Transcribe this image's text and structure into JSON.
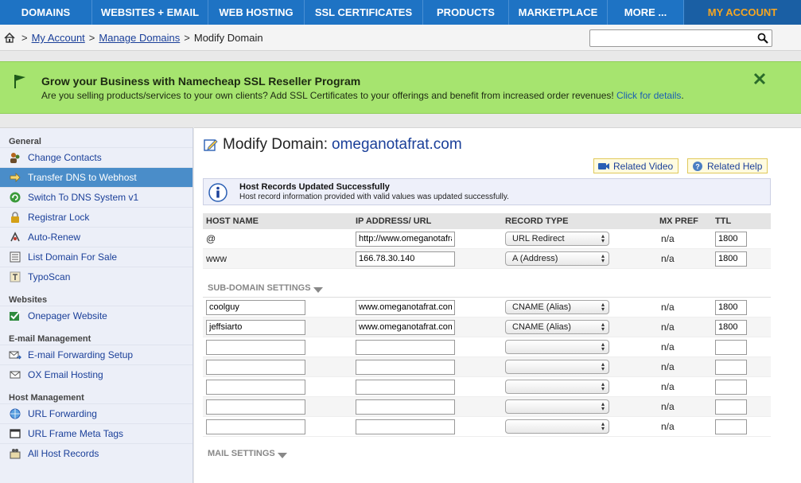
{
  "nav": {
    "items": [
      "DOMAINS",
      "WEBSITES + EMAIL",
      "WEB HOSTING",
      "SSL CERTIFICATES",
      "PRODUCTS",
      "MARKETPLACE",
      "MORE ...",
      "MY ACCOUNT"
    ]
  },
  "breadcrumb": {
    "my_account": "My Account",
    "manage_domains": "Manage Domains",
    "current": "Modify Domain",
    "separator": ">"
  },
  "search": {
    "value": "",
    "placeholder": ""
  },
  "banner": {
    "title": "Grow your Business with Namecheap SSL Reseller Program",
    "text": "Are you selling products/services to your own clients? Add SSL Certificates to your offerings and benefit from increased order revenues! ",
    "link": "Click for details",
    "text_end": "."
  },
  "sidebar": {
    "sections": [
      {
        "title": "General",
        "items": [
          {
            "label": "Change Contacts",
            "icon": "contacts-icon"
          },
          {
            "label": "Transfer DNS to Webhost",
            "icon": "arrow-right-icon",
            "active": true
          },
          {
            "label": "Switch To DNS System v1",
            "icon": "refresh-icon"
          },
          {
            "label": "Registrar Lock",
            "icon": "lock-icon"
          },
          {
            "label": "Auto-Renew",
            "icon": "renew-icon"
          },
          {
            "label": "List Domain For Sale",
            "icon": "list-icon"
          },
          {
            "label": "TypoScan",
            "icon": "typoscan-icon"
          }
        ]
      },
      {
        "title": "Websites",
        "items": [
          {
            "label": "Onepager Website",
            "icon": "checkmark-icon"
          }
        ]
      },
      {
        "title": "E-mail Management",
        "items": [
          {
            "label": "E-mail Forwarding Setup",
            "icon": "email-forward-icon"
          },
          {
            "label": "OX Email Hosting",
            "icon": "email-icon"
          }
        ]
      },
      {
        "title": "Host Management",
        "items": [
          {
            "label": "URL Forwarding",
            "icon": "globe-icon"
          },
          {
            "label": "URL Frame Meta Tags",
            "icon": "frame-icon"
          },
          {
            "label": "All Host Records",
            "icon": "host-records-icon"
          }
        ]
      }
    ]
  },
  "main": {
    "title": "Modify Domain:",
    "domain": "omeganotafrat.com",
    "related_video": "Related Video",
    "related_help": "Related Help",
    "message_title": "Host Records Updated Successfully",
    "message_text": "Host record information provided with valid values was updated successfully.",
    "headers": [
      "HOST NAME",
      "IP ADDRESS/ URL",
      "RECORD TYPE",
      "MX PREF",
      "TTL"
    ],
    "host_records": [
      {
        "host": "@",
        "ip": "http://www.omeganotafrat.com",
        "type": "URL Redirect",
        "mx": "n/a",
        "ttl": "1800"
      },
      {
        "host": "www",
        "ip": "166.78.30.140",
        "type": "A (Address)",
        "mx": "n/a",
        "ttl": "1800"
      }
    ],
    "subdomain_label": "SUB-DOMAIN SETTINGS",
    "subdomains": [
      {
        "host": "coolguy",
        "ip": "www.omeganotafrat.com",
        "type": "CNAME (Alias)",
        "mx": "n/a",
        "ttl": "1800"
      },
      {
        "host": "jeffsiarto",
        "ip": "www.omeganotafrat.com",
        "type": "CNAME (Alias)",
        "mx": "n/a",
        "ttl": "1800"
      },
      {
        "host": "",
        "ip": "",
        "type": "",
        "mx": "n/a",
        "ttl": ""
      },
      {
        "host": "",
        "ip": "",
        "type": "",
        "mx": "n/a",
        "ttl": ""
      },
      {
        "host": "",
        "ip": "",
        "type": "",
        "mx": "n/a",
        "ttl": ""
      },
      {
        "host": "",
        "ip": "",
        "type": "",
        "mx": "n/a",
        "ttl": ""
      },
      {
        "host": "",
        "ip": "",
        "type": "",
        "mx": "n/a",
        "ttl": ""
      }
    ],
    "mail_label": "MAIL SETTINGS"
  },
  "colors": {
    "nav_bg": "#1e73c4",
    "nav_active_text": "#f5a623",
    "banner_bg": "#a6e46f",
    "sidebar_active": "#4a8dc9",
    "link": "#1a3f99"
  }
}
